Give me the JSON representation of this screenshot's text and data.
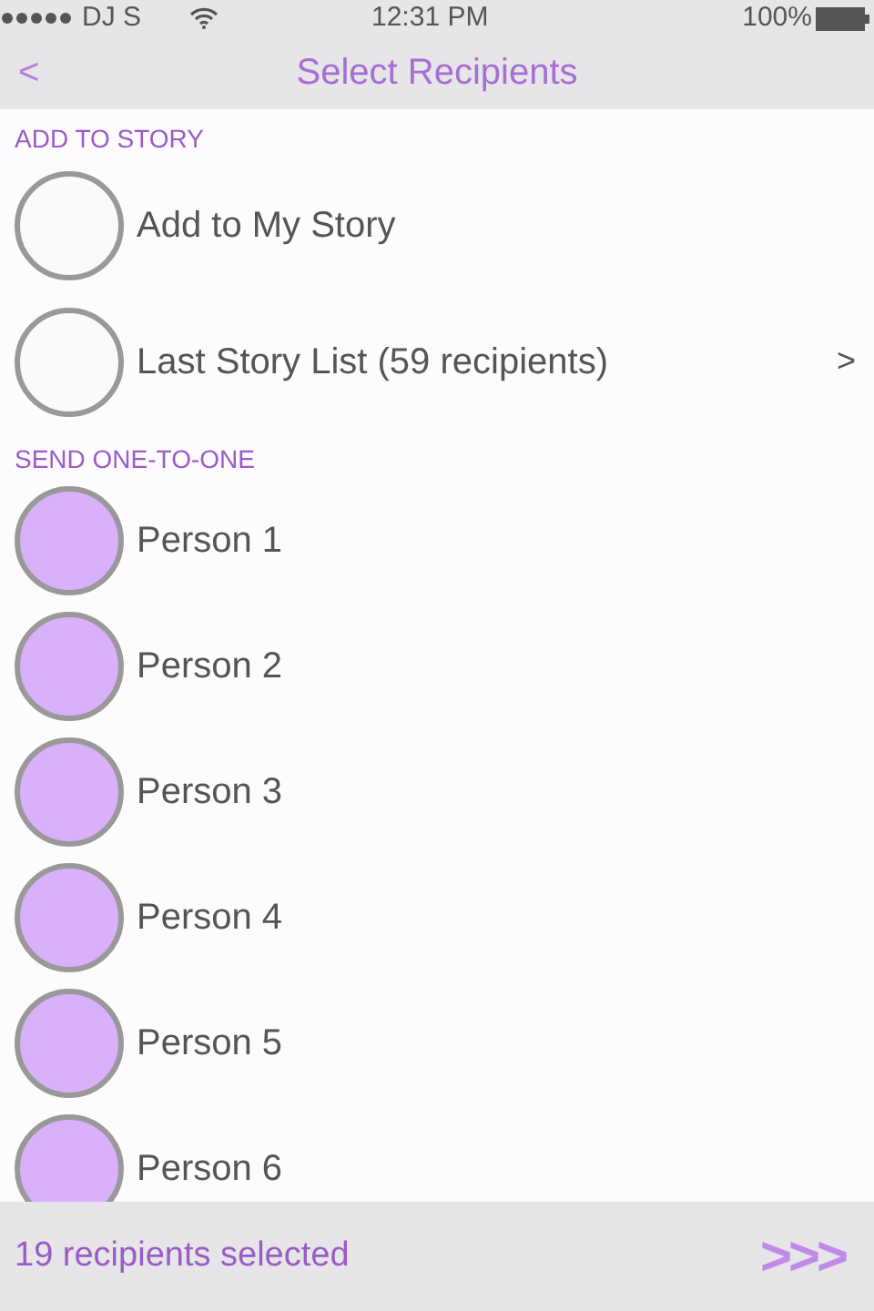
{
  "status_bar": {
    "carrier": "DJ S",
    "time": "12:31 PM",
    "battery": "100%"
  },
  "nav": {
    "back": "<",
    "title": "Select Recipients"
  },
  "sections": [
    {
      "title": "ADD TO STORY",
      "items": [
        {
          "label": "Add to My Story",
          "selected": false
        },
        {
          "label": "Last Story List (59 recipients)",
          "selected": false,
          "chevron": ">"
        }
      ]
    },
    {
      "title": "SEND ONE-TO-ONE",
      "items": [
        {
          "label": "Person 1",
          "selected": true
        },
        {
          "label": "Person 2",
          "selected": true
        },
        {
          "label": "Person 3",
          "selected": true
        },
        {
          "label": "Person 4",
          "selected": true
        },
        {
          "label": "Person 5",
          "selected": true
        },
        {
          "label": "Person 6",
          "selected": true
        }
      ]
    }
  ],
  "footer": {
    "summary": "19 recipients selected",
    "next": ">>>"
  }
}
